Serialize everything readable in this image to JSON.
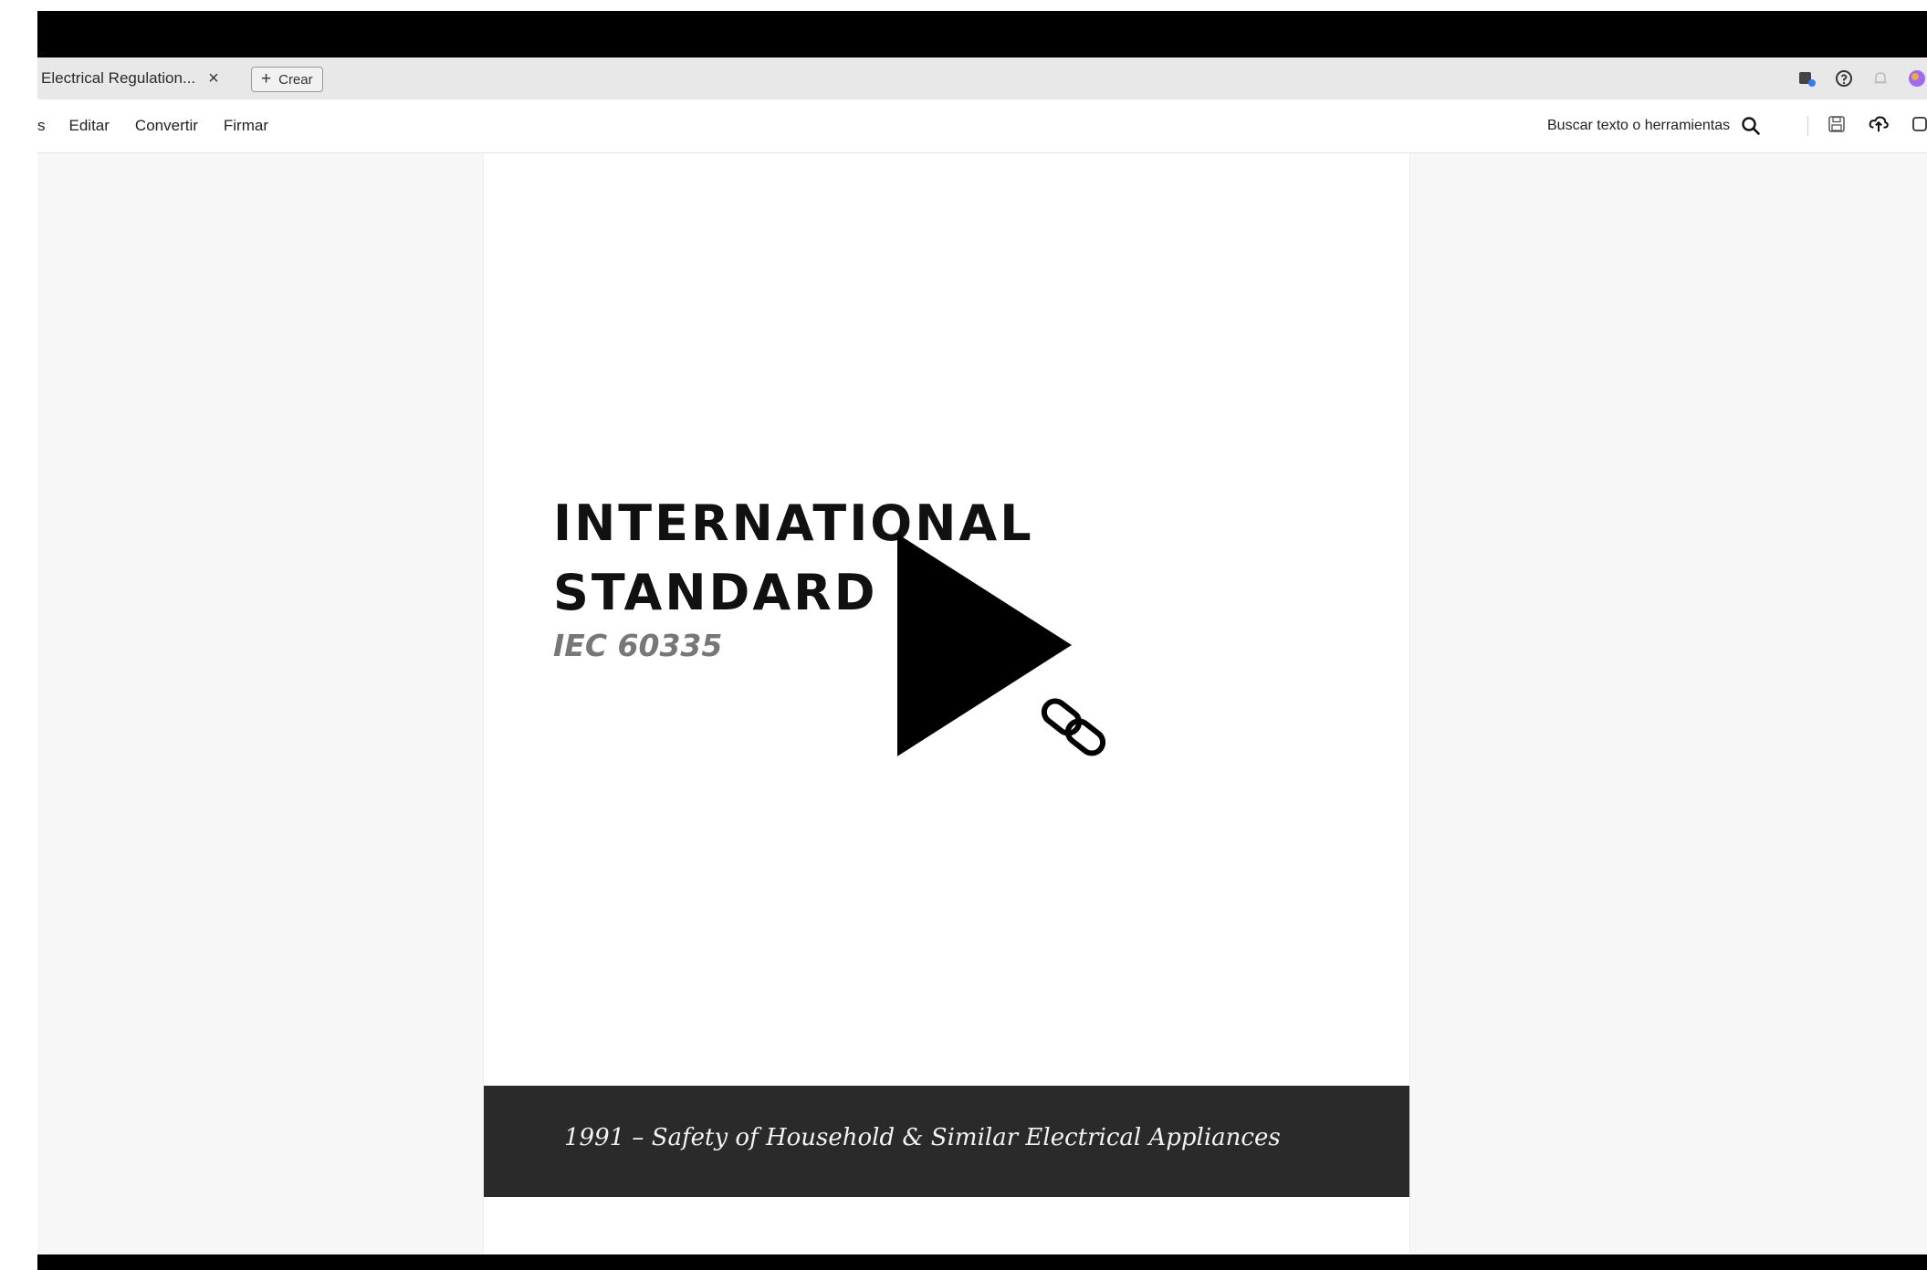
{
  "tabs": {
    "active_label": "Electrical Regulation...",
    "close_symbol": "×",
    "create_label": "Crear",
    "create_symbol": "+"
  },
  "header_icons": [
    "user-badge-icon",
    "help-icon",
    "bell-icon",
    "profile-avatar-icon"
  ],
  "menu": {
    "items": [
      "s",
      "Editar",
      "Convertir",
      "Firmar"
    ]
  },
  "search": {
    "label": "Buscar texto o herramientas"
  },
  "toolbar_icons": [
    "save-icon",
    "cloud-upload-icon",
    "share-icon"
  ],
  "document": {
    "title_line1": "INTERNATIONAL",
    "title_line2": "STANDARD",
    "code": "IEC 60335",
    "band_text": "1991 – Safety of Household & Similar Electrical Appliances"
  },
  "overlay": {
    "play_icon": "play-icon",
    "link_icon": "link-icon"
  },
  "colors": {
    "band": "#2a2a2a",
    "title": "#111111",
    "code": "#777777",
    "avatar": "#a06af0"
  }
}
